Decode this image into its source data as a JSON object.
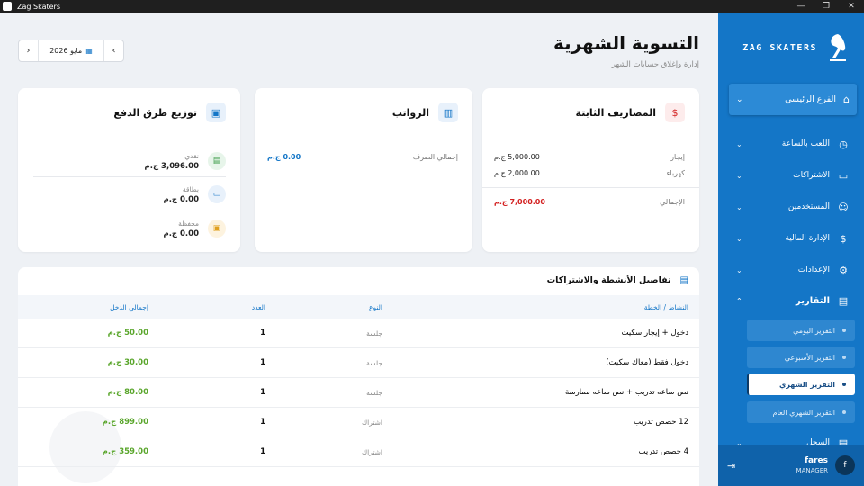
{
  "window": {
    "title": "Zag Skaters"
  },
  "sidebar": {
    "brand": "ZAG SKATERS",
    "branch": "الفرع الرئيسي",
    "items": [
      {
        "label": "اللعب بالساعة",
        "icon": "clock-icon"
      },
      {
        "label": "الاشتراكات",
        "icon": "card-icon"
      },
      {
        "label": "المستخدمين",
        "icon": "users-icon"
      },
      {
        "label": "الإدارة المالية",
        "icon": "dollar-icon"
      },
      {
        "label": "الإعدادات",
        "icon": "gear-icon"
      },
      {
        "label": "التقارير",
        "icon": "report-icon"
      },
      {
        "label": "السجل",
        "icon": "log-icon"
      }
    ],
    "subitems": [
      {
        "label": "التقرير اليومي"
      },
      {
        "label": "التقرير الأسبوعي"
      },
      {
        "label": "التقرير الشهري"
      },
      {
        "label": "التقرير الشهري العام"
      }
    ],
    "user": {
      "name": "fares",
      "role": "MANAGER",
      "initial": "f"
    }
  },
  "header": {
    "title": "التسوية الشهرية",
    "subtitle": "إدارة وإغلاق حسابات الشهر",
    "month": "مايو 2026"
  },
  "fixed_expenses": {
    "title": "المصاريف الثابتة",
    "rows": [
      {
        "label": "إيجار",
        "value": "5,000.00 ج.م"
      },
      {
        "label": "كهرباء",
        "value": "2,000.00 ج.م"
      }
    ],
    "total_label": "الإجمالي",
    "total_value": "7,000.00 ج.م"
  },
  "salaries": {
    "title": "الرواتب",
    "label": "إجمالي الصرف",
    "value": "0.00 ج.م"
  },
  "payment_methods": {
    "title": "توزيع طرق الدفع",
    "items": [
      {
        "label": "نقدي",
        "value": "3,096.00 ج.م"
      },
      {
        "label": "بطاقة",
        "value": "0.00 ج.م"
      },
      {
        "label": "محفظة",
        "value": "0.00 ج.م"
      }
    ]
  },
  "activities": {
    "title": "تفاصيل الأنشطة والاشتراكات",
    "columns": [
      "النشاط / الخطة",
      "النوع",
      "العدد",
      "إجمالي الدخل"
    ],
    "rows": [
      {
        "name": "دخول + إيجار سكيت",
        "type": "جلسة",
        "count": "1",
        "total": "50.00 ج.م"
      },
      {
        "name": "دخول فقط (معاك سكيت)",
        "type": "جلسة",
        "count": "1",
        "total": "30.00 ج.م"
      },
      {
        "name": "نص ساعه تدريب + نص ساعه ممارسة",
        "type": "جلسة",
        "count": "1",
        "total": "80.00 ج.م"
      },
      {
        "name": "12 حصص تدريب",
        "type": "اشتراك",
        "count": "1",
        "total": "899.00 ج.م"
      },
      {
        "name": "4 حصص تدريب",
        "type": "اشتراك",
        "count": "1",
        "total": "359.00 ج.م"
      }
    ]
  },
  "colors": {
    "accent": "#1476c7",
    "danger": "#d32020",
    "success": "#5aa62c"
  }
}
